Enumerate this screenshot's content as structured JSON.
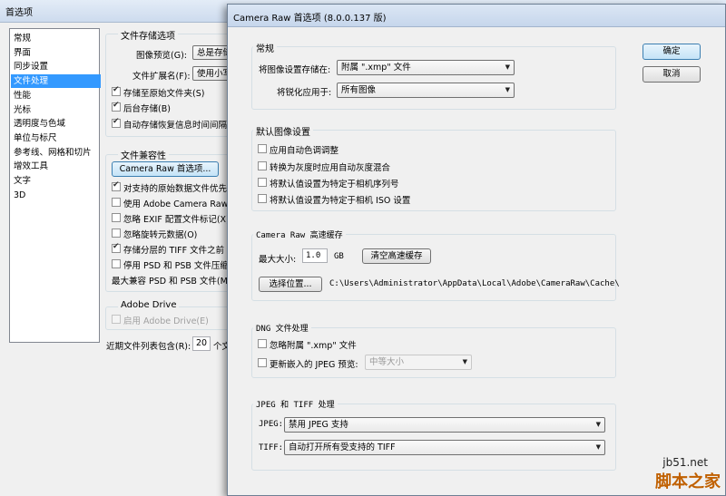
{
  "back_window": {
    "title": "首选项",
    "sidebar": [
      "常规",
      "界面",
      "同步设置",
      "文件处理",
      "性能",
      "光标",
      "透明度与色域",
      "单位与标尺",
      "参考线、网格和切片",
      "增效工具",
      "文字",
      "3D"
    ],
    "sidebar_selected_index": 3,
    "file_save": {
      "group_title": "文件存储选项",
      "preview_label": "图像预览(G):",
      "preview_value": "总是存储",
      "ext_label": "文件扩展名(F):",
      "ext_value": "使用小写",
      "cb_save_original": "存储至原始文件夹(S)",
      "cb_background": "后台存储(B)",
      "cb_autosave": "自动存储恢复信息时间间隔"
    },
    "compat": {
      "group_title": "文件兼容性",
      "camera_raw_button": "Camera Raw 首选项...",
      "cb_prefer_raw": "对支持的原始数据文件优先",
      "cb_use_acr": "使用 Adobe Camera Raw 将",
      "cb_ignore_exif": "忽略 EXIF 配置文件标记(X)",
      "cb_ignore_rotation": "忽略旋转元数据(O)",
      "cb_layered_tiff": "存储分层的 TIFF 文件之前",
      "cb_disable_compress": "停用 PSD 和 PSB 文件压缩",
      "max_compat_label": "最大兼容 PSD 和 PSB 文件(M)"
    },
    "drive": {
      "group_title": "Adobe Drive",
      "cb_enable": "启用 Adobe Drive(E)"
    },
    "recent_label": "近期文件列表包含(R):",
    "recent_value": "20",
    "recent_suffix": "个文"
  },
  "front_window": {
    "title": "Camera Raw 首选项 (8.0.0.137 版)",
    "ok_button": "确定",
    "cancel_button": "取消",
    "general": {
      "group_title": "常规",
      "save_settings_label": "将图像设置存储在:",
      "save_settings_value": "附属 \".xmp\" 文件",
      "sharpen_label": "将锐化应用于:",
      "sharpen_value": "所有图像"
    },
    "default_settings": {
      "group_title": "默认图像设置",
      "cb_auto_tone": "应用自动色调调整",
      "cb_auto_gray": "转换为灰度时应用自动灰度混合",
      "cb_serial": "将默认值设置为特定于相机序列号",
      "cb_iso": "将默认值设置为特定于相机 ISO 设置"
    },
    "cache": {
      "group_title": "Camera Raw 高速缓存",
      "max_size_label": "最大大小:",
      "max_size_value": "1.0",
      "unit": "GB",
      "purge_button": "清空高速缓存",
      "select_button": "选择位置...",
      "path": "C:\\Users\\Administrator\\AppData\\Local\\Adobe\\CameraRaw\\Cache\\"
    },
    "dng": {
      "group_title": "DNG 文件处理",
      "cb_ignore_xmp": "忽略附属 \".xmp\" 文件",
      "cb_update_jpeg": "更新嵌入的 JPEG 预览:",
      "jpeg_preview_value": "中等大小"
    },
    "jpeg_tiff": {
      "group_title": "JPEG 和 TIFF 处理",
      "jpeg_label": "JPEG:",
      "jpeg_value": "禁用 JPEG 支持",
      "tiff_label": "TIFF:",
      "tiff_value": "自动打开所有受支持的 TIFF"
    }
  },
  "watermark": {
    "site": "jb51.net",
    "brand": "脚本之家"
  }
}
